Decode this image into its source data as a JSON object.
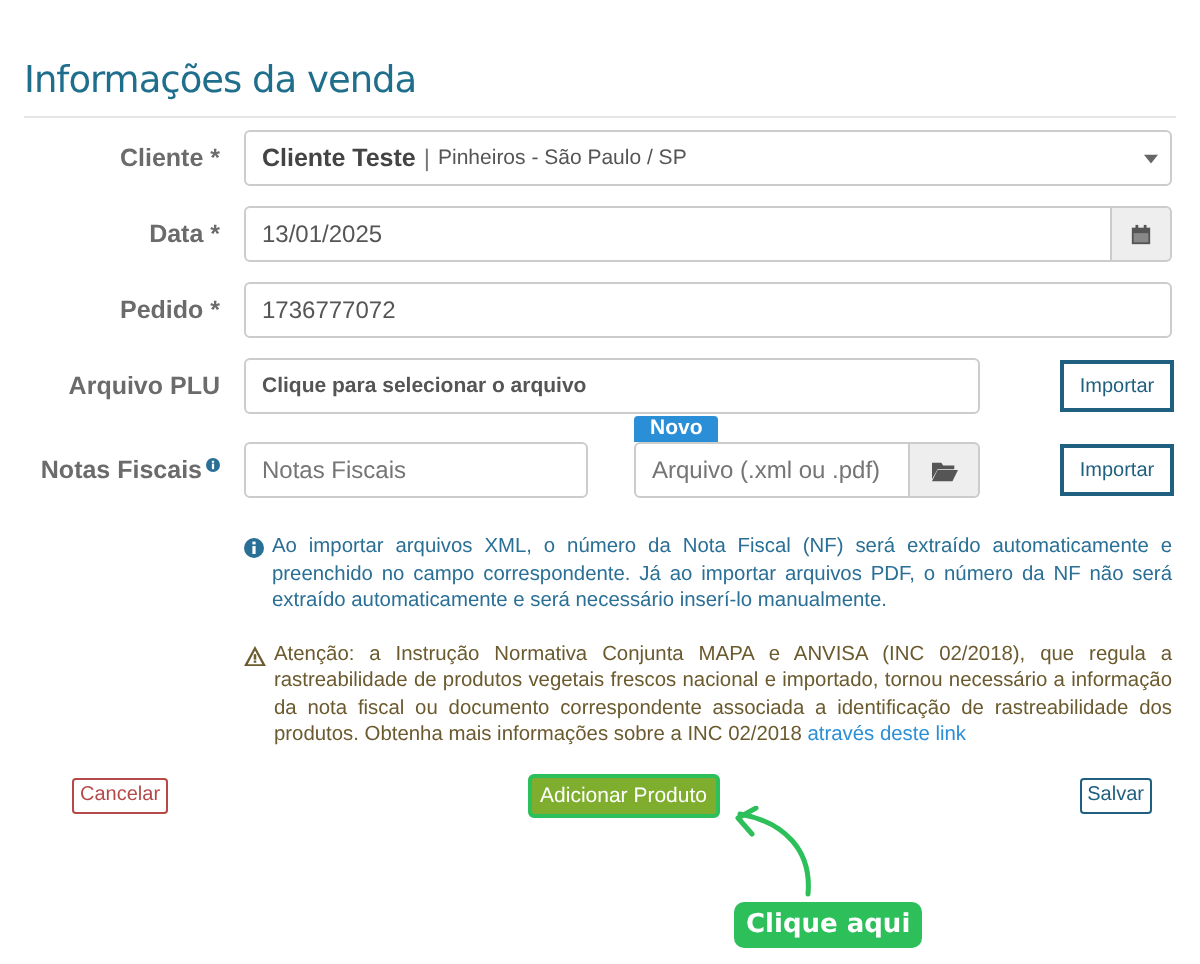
{
  "title": "Informações da venda",
  "fields": [
    {
      "kind": "select",
      "label": "Cliente  *",
      "value": "Cliente Teste",
      "separator": "|",
      "detail": "Pinheiros - São Paulo / SP"
    },
    {
      "kind": "date",
      "label": "Data *",
      "value": "13/01/2025"
    },
    {
      "kind": "text",
      "label": "Pedido *",
      "value": "1736777072"
    },
    {
      "kind": "file",
      "label": "Arquivo PLU",
      "value": "Clique para selecionar o arquivo",
      "button": "Importar"
    },
    {
      "kind": "notes",
      "label": "Notas Fiscais",
      "placeholder": "Notas Fiscais",
      "file_placeholder": "Arquivo (.xml ou .pdf)",
      "badge": "Novo",
      "button": "Importar"
    }
  ],
  "info": "Ao importar arquivos XML, o número da Nota Fiscal (NF) será extraído automaticamente e preenchido no campo correspondente. Já ao importar arquivos PDF, o número da NF não será extraído automaticamente e será necessário inserí-lo manualmente.",
  "warning": {
    "text": "Atenção: a Instrução Normativa Conjunta MAPA e ANVISA (INC 02/2018), que regula a rastreabilidade de produtos vegetais frescos nacional e importado, tornou necessário a informação da nota fiscal ou documento correspondente associada a identificação de rastreabilidade dos produtos. Obtenha mais informações sobre a INC 02/2018",
    "link": "através deste link"
  },
  "actions": {
    "cancel": "Cancelar",
    "add": "Adicionar Produto",
    "save": "Salvar"
  },
  "callout": "Clique aqui"
}
